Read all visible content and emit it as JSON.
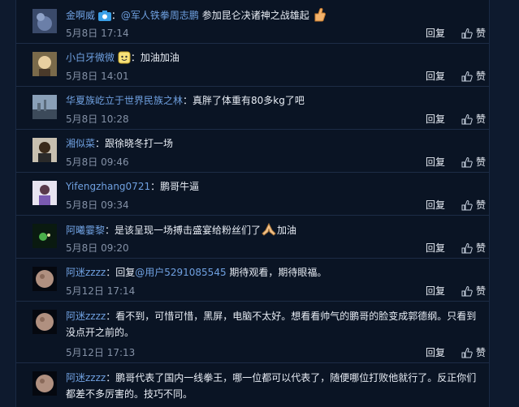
{
  "comments": [
    {
      "name": "金啊威",
      "colon": "：",
      "mention": "@军人铁拳周志鹏",
      "text": " 参加昆仑决诸神之战雄起",
      "time": "5月8日 17:14"
    },
    {
      "name": "小白牙微微",
      "colon": "：",
      "text": "加油加油",
      "time": "5月8日 14:01"
    },
    {
      "name": "华夏族屹立于世界民族之林",
      "colon": "：",
      "text": "真胖了体重有80多kg了吧",
      "time": "5月8日 10:28"
    },
    {
      "name": "湘似菜",
      "colon": "：",
      "text": "跟徐晓冬打一场",
      "time": "5月8日 09:46"
    },
    {
      "name": "Yifengzhang0721",
      "colon": "：",
      "text": "鹏哥牛逼",
      "time": "5月8日 09:34"
    },
    {
      "name": "阿曦霎黎",
      "colon": "：",
      "text": "是该呈现一场搏击盛宴给粉丝们了",
      "text2": "加油",
      "time": "5月8日 09:20"
    },
    {
      "name": "阿迷zzzz",
      "colon": "：",
      "prefix": "回复",
      "mention": "@用户5291085545",
      "text": " 期待观看，期待眼福。",
      "time": "5月12日 17:14"
    },
    {
      "name": "阿迷zzzz",
      "colon": "：",
      "text": "看不到，可惜可惜，黑屏，电脑不太好。想看看帅气的鹏哥的脸变成郭德纲。只看到没点开之前的。",
      "time": "5月12日 17:13"
    },
    {
      "name": "阿迷zzzz",
      "colon": "：",
      "text": "鹏哥代表了国内一线拳王，哪一位都可以代表了，随便哪位打败他就行了。反正你们都差不多厉害的。技巧不同。"
    }
  ],
  "actions": {
    "reply": "回复",
    "like": "赞"
  },
  "icons": {
    "like": "thumbs-up-icon",
    "verified": "camera-badge-icon",
    "emoji_thumb": "thumbs-up-emoji",
    "emoji_cute": "smile-emoji",
    "emoji_pray": "pray-emoji"
  }
}
